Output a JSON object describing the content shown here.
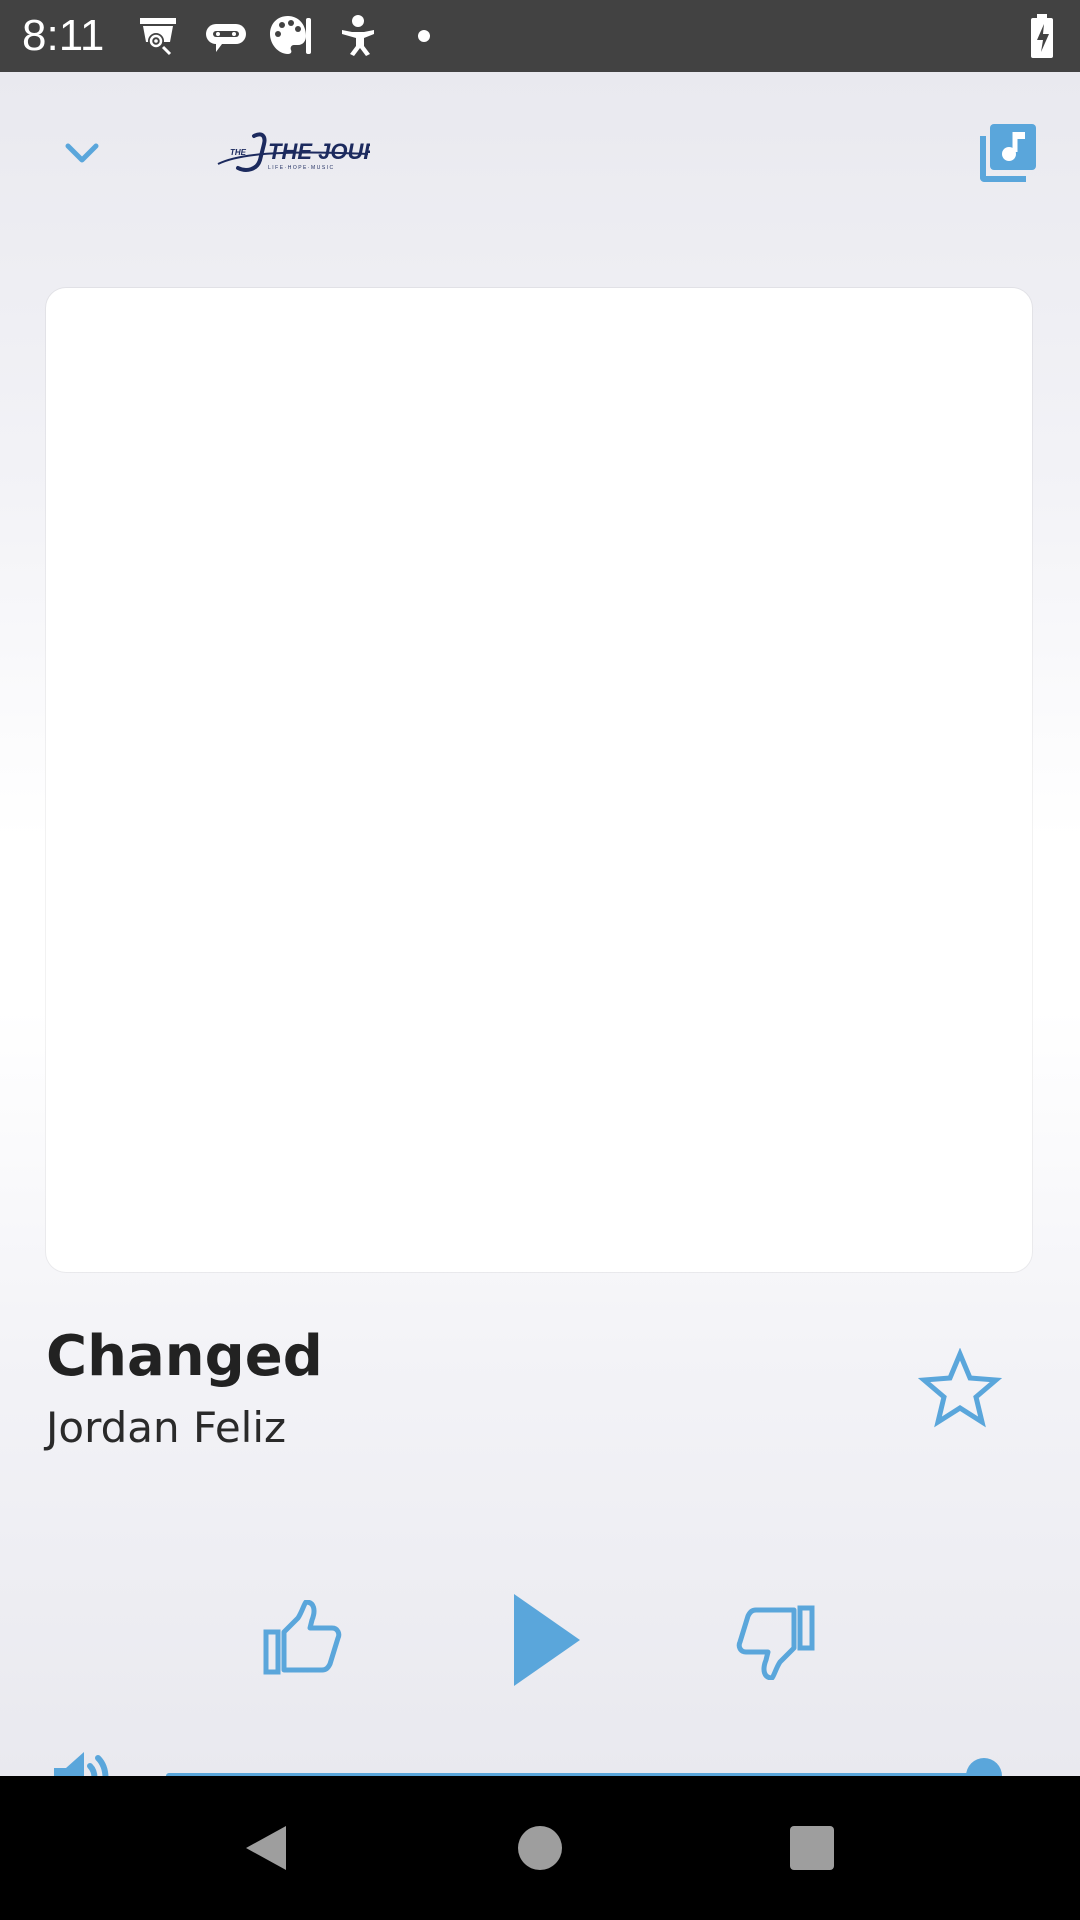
{
  "status_bar": {
    "time": "8:11",
    "icons": [
      "webcam-icon",
      "robot-face-icon",
      "palette-icon",
      "baby-icon",
      "notification-dot-icon",
      "battery-charging-icon"
    ]
  },
  "header": {
    "logo_text": "THE JOURNEY",
    "logo_tagline": "LIFE·HOPE·MUSIC",
    "collapse_icon": "chevron-down-icon",
    "queue_icon": "music-library-icon"
  },
  "track": {
    "title": "Changed",
    "artist": "Jordan Feliz"
  },
  "controls": {
    "favorite_icon": "star-outline-icon",
    "thumbs_up_icon": "thumbs-up-icon",
    "play_icon": "play-icon",
    "thumbs_down_icon": "thumbs-down-icon"
  },
  "volume": {
    "icon": "volume-icon",
    "level": 1.0
  },
  "nav_bar": {
    "back_icon": "back-triangle-icon",
    "home_icon": "home-circle-icon",
    "recents_icon": "recents-square-icon"
  },
  "colors": {
    "accent": "#5aa6db",
    "logo_navy": "#1c2a5e",
    "status_bar": "#424242",
    "title_text": "#222222"
  }
}
